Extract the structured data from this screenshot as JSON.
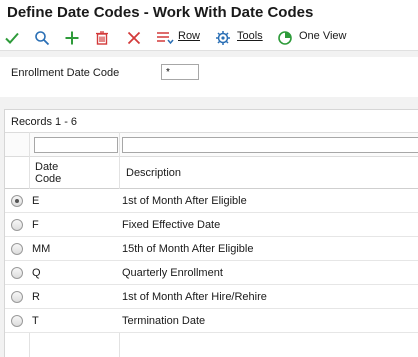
{
  "window": {
    "title": "Define Date Codes - Work With Date Codes"
  },
  "toolbar": {
    "select_icon": "checkmark-icon",
    "find_icon": "search-icon",
    "add_icon": "plus-icon",
    "delete_icon": "trash-icon",
    "close_icon": "x-icon",
    "row_label": "Row",
    "tools_label": "Tools",
    "oneview_label": "One View",
    "colors": {
      "green": "#2e9b3a",
      "blue": "#2a6fb5",
      "red": "#d33a3a"
    }
  },
  "criteria": {
    "label": "Enrollment Date Code",
    "value": "*"
  },
  "grid": {
    "records_label": "Records 1 - 6",
    "columns": {
      "code": "Date Code",
      "description": "Description"
    },
    "rows": [
      {
        "code": "E",
        "description": "1st of Month After Eligible",
        "selected": true
      },
      {
        "code": "F",
        "description": "Fixed Effective Date",
        "selected": false
      },
      {
        "code": "MM",
        "description": "15th of Month After Eligible",
        "selected": false
      },
      {
        "code": "Q",
        "description": "Quarterly Enrollment",
        "selected": false
      },
      {
        "code": "R",
        "description": "1st of Month After Hire/Rehire",
        "selected": false
      },
      {
        "code": "T",
        "description": "Termination Date",
        "selected": false
      }
    ]
  }
}
